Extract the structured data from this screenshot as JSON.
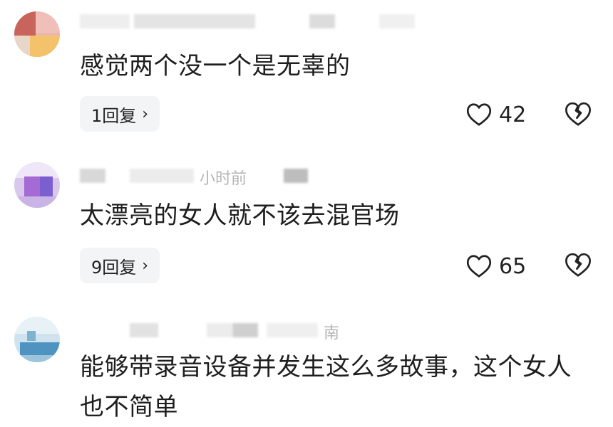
{
  "comments": [
    {
      "time": "",
      "text": "感觉两个没一个是无辜的",
      "replies_label": "1回复",
      "likes": "42"
    },
    {
      "time": "小时前",
      "text": "太漂亮的女人就不该去混官场",
      "replies_label": "9回复",
      "likes": "65"
    },
    {
      "time": "南",
      "text": "能够带录音设备并发生这么多故事，这个女人也不简单",
      "replies_label": "",
      "likes": ""
    }
  ],
  "icons": {
    "like": "heart-outline-icon",
    "dislike": "broken-heart-icon",
    "reply_more": "chevron-right-icon"
  }
}
